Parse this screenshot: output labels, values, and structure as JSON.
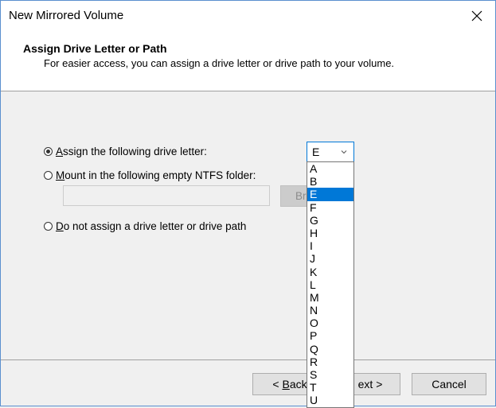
{
  "window": {
    "title": "New Mirrored Volume"
  },
  "header": {
    "title": "Assign Drive Letter or Path",
    "subtitle": "For easier access, you can assign a drive letter or drive path to your volume."
  },
  "options": {
    "assign_letter": {
      "prefix": "",
      "key": "A",
      "rest": "ssign the following drive letter:",
      "checked": true
    },
    "mount_folder": {
      "prefix": "",
      "key": "M",
      "rest": "ount in the following empty NTFS folder:",
      "checked": false
    },
    "no_assign": {
      "prefix": "",
      "key": "D",
      "rest": "o not assign a drive letter or drive path",
      "checked": false
    }
  },
  "folder_path": {
    "value": ""
  },
  "browse_button": {
    "label": "Bro"
  },
  "drive_combo": {
    "value": "E"
  },
  "dropdown": {
    "items": [
      "A",
      "B",
      "E",
      "F",
      "G",
      "H",
      "I",
      "J",
      "K",
      "L",
      "M",
      "N",
      "O",
      "P",
      "Q",
      "R",
      "S",
      "T",
      "U"
    ],
    "selected": "E"
  },
  "buttons": {
    "back": {
      "pre": "< ",
      "key": "B",
      "rest": "ack"
    },
    "next": {
      "visible": "ext >"
    },
    "cancel": "Cancel"
  },
  "colors": {
    "accent": "#0078d7",
    "button_bg": "#e1e1e1"
  }
}
